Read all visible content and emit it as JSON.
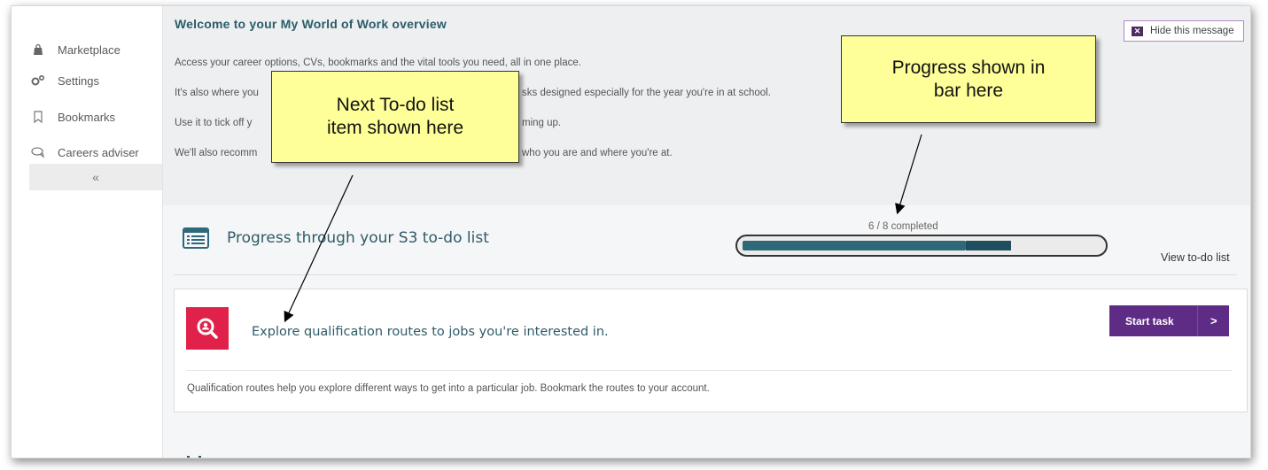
{
  "sidebar": {
    "items": [
      {
        "label": "Marketplace",
        "icon": "shopping-bag-icon"
      },
      {
        "label": "Settings",
        "icon": "gears-icon"
      },
      {
        "label": "Bookmarks",
        "icon": "bookmark-icon"
      },
      {
        "label": "Careers adviser",
        "icon": "chat-icon"
      }
    ],
    "collapse_label": "«"
  },
  "welcome": {
    "title": "Welcome to your My World of Work overview",
    "lines": [
      "Access your career options, CVs, bookmarks and the vital tools you need, all in one place.",
      "It's also where you",
      "sks designed especially for the year you're in at school.",
      "Use it to tick off y",
      "ming up.",
      "We'll also recomm",
      "who you are and where you're at."
    ],
    "hide_label": "Hide this message"
  },
  "progress": {
    "title": "Progress through your S3 to-do list",
    "caption": "6 / 8 completed",
    "completed": 6,
    "total": 8,
    "view_link": "View to-do list"
  },
  "task": {
    "title": "Explore qualification routes to jobs you're interested in.",
    "button_label": "Start task",
    "button_chevron": ">",
    "description": "Qualification routes help you explore different ways to get into a particular job. Bookmark the routes to your account."
  },
  "callouts": {
    "todo": [
      "Next To-do list",
      "item shown here"
    ],
    "progress": [
      "Progress shown in",
      "bar here"
    ]
  },
  "colors": {
    "accent_teal": "#2f6979",
    "task_red": "#e0224a",
    "button_purple": "#5e2c85",
    "callout_yellow": "#ffff99"
  }
}
